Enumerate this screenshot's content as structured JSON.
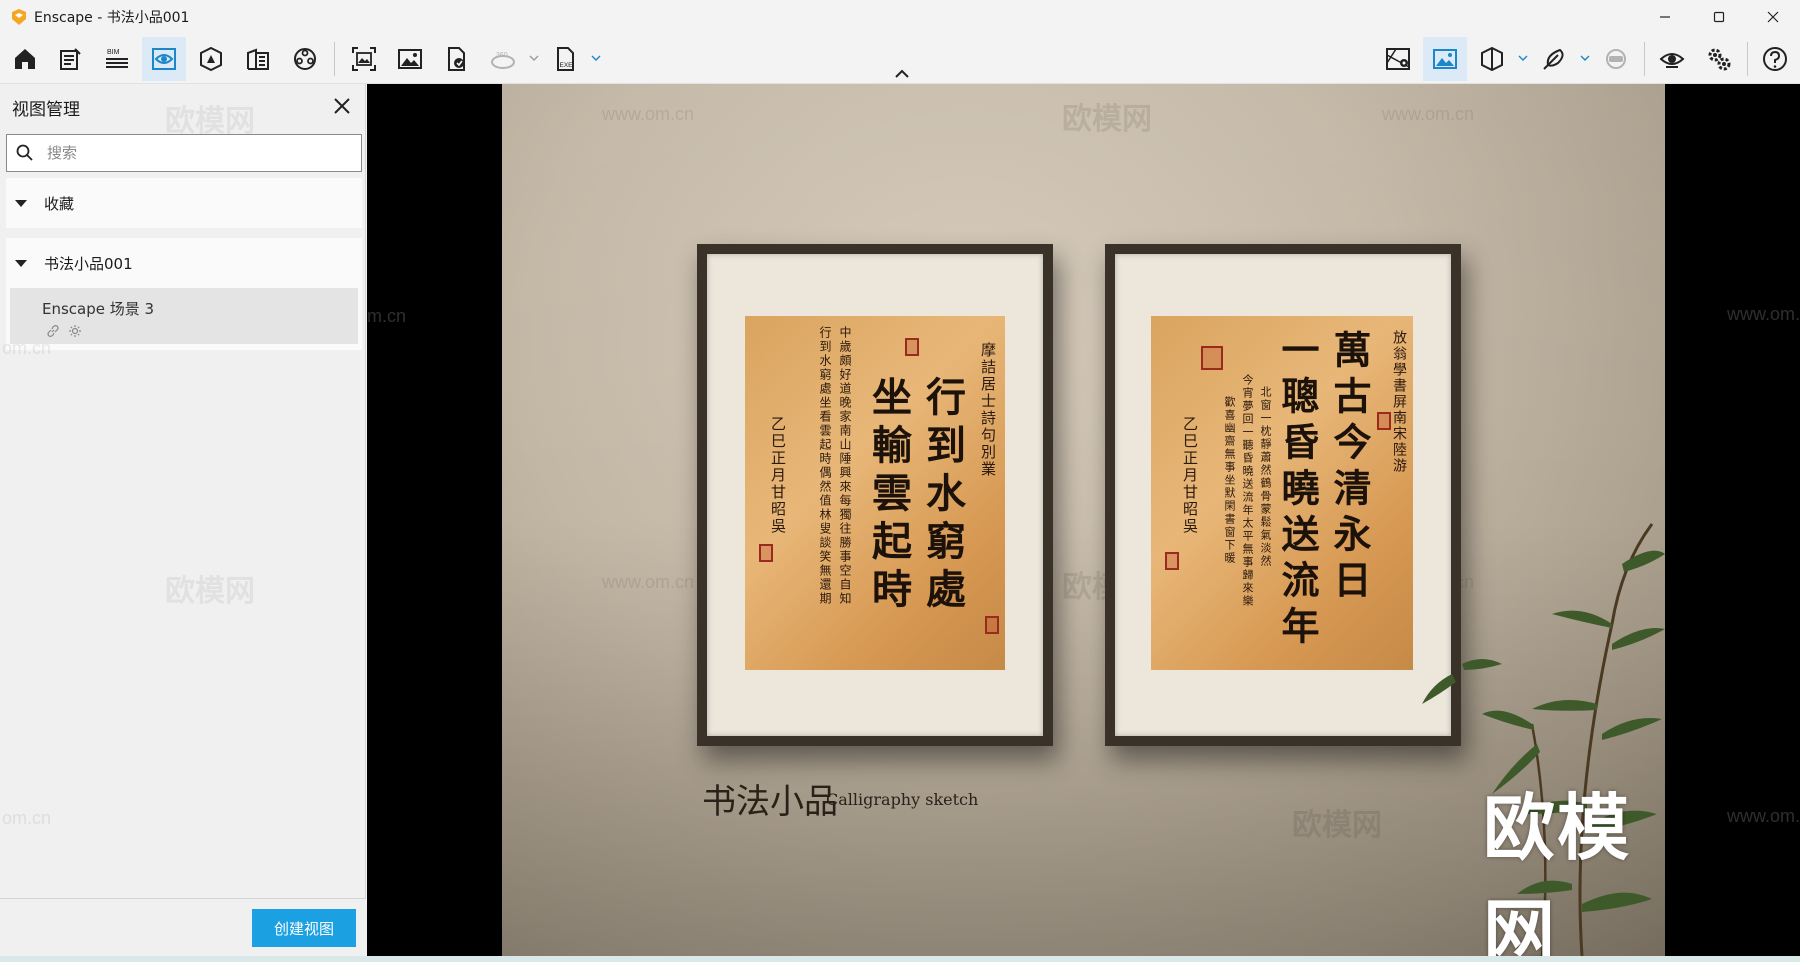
{
  "window": {
    "title": "Enscape - 书法小品001",
    "controls": [
      "minimize-icon",
      "maximize-icon",
      "close-icon"
    ]
  },
  "toolbar": {
    "left_tools": [
      "home-icon",
      "notes-icon",
      "bim-icon",
      "view-management-icon",
      "asset-library-icon",
      "material-editor-icon",
      "video-editor-icon",
      "batch-render-icon",
      "screenshot-icon",
      "panorama-360-icon",
      "upload-icon",
      "export-exe-icon"
    ],
    "bim_label": "BIM",
    "exe_label": "EXE",
    "pano_label": "360",
    "right_tools": [
      "map-icon",
      "image-view-icon",
      "cube-icon",
      "feather-icon",
      "vr-headset-icon",
      "eye-icon",
      "settings-icon",
      "help-icon"
    ],
    "active_tool": "view-management-icon",
    "accent_color": "#1ba1e2"
  },
  "panel": {
    "title": "视图管理",
    "search_placeholder": "搜索",
    "sections": [
      {
        "label": "收藏",
        "expanded": true,
        "items": []
      },
      {
        "label": "书法小品001",
        "expanded": true,
        "items": [
          {
            "name": "Enscape 场景 3",
            "icons": [
              "link-icon",
              "sun-icon"
            ]
          }
        ]
      }
    ],
    "create_button": "创建视图"
  },
  "render": {
    "caption_cn": "书法小品",
    "caption_en": "Calligraphy sketch",
    "brand": "欧模网",
    "watermark_cn": "欧模网",
    "watermark_url": "www.om.cn",
    "watermark_url_short": "om.cn",
    "left_scroll": {
      "big_col_1": "行到水窮處",
      "big_col_2": "坐輸雲起時",
      "small_col_1": "摩詰居士詩句別業",
      "small_col_2": "中歲頗好道晚家南山陲興來每獨往勝事空自知",
      "small_col_3": "行到水窮處坐看雲起時偶然值林叟談笑無還期",
      "signature": "乙巳正月甘昭吳"
    },
    "right_scroll": {
      "big_col_1": "萬古今清永日",
      "big_col_2": "一聰昏曉送流年",
      "small_col_1": "放翁學書屏南宋陸游",
      "small_col_2": "北窗一枕靜蕭然鶴骨蒙鬆氣淡然",
      "small_col_3": "今宵夢回一聽昏曉送流年太平無事歸來樂",
      "small_col_4": "歡喜幽齋無事坐默閑書窗下暖",
      "signature": "乙巳正月甘昭吳"
    }
  }
}
